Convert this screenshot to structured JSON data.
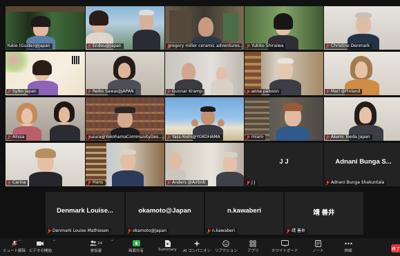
{
  "participants": [
    {
      "name": "Yukie (Guide)@Japan",
      "muted": false
    },
    {
      "name": "Endou@Japan",
      "muted": true
    },
    {
      "name": "gregory miller ceramic adventures...",
      "muted": true
    },
    {
      "name": "Yukiko Shiraiwa",
      "muted": true
    },
    {
      "name": "Christine Denmark",
      "muted": true
    },
    {
      "name": "Syiko Japan",
      "muted": true
    },
    {
      "name": "Reiko Sawai@JAPAN",
      "muted": true
    },
    {
      "name": "Gunnar Kramp",
      "muted": true
    },
    {
      "name": "anna pålsson",
      "muted": true
    },
    {
      "name": "Mari @Finland",
      "muted": true
    },
    {
      "name": "Alissa",
      "muted": true
    },
    {
      "name": "suiura@YokohamaCommunityDes...",
      "muted": true
    },
    {
      "name": "Yass-Yoshi@YOKOHAMA",
      "muted": true
    },
    {
      "name": "miaro",
      "muted": true
    },
    {
      "name": "Akemi Toeda Japan",
      "muted": true
    },
    {
      "name": "Carina",
      "muted": true
    },
    {
      "name": "Hans",
      "muted": true
    },
    {
      "name": "Anders @Airbnb",
      "muted": true
    },
    {
      "name": "J J",
      "display": "J J",
      "muted": true
    },
    {
      "name": "Adnani Bunga Shakuntala",
      "display": "Adnani Bunga S...",
      "muted": true
    },
    {
      "name": "Denmark Louise Mathiesen",
      "display": "Denmark  Louise...",
      "muted": true
    },
    {
      "name": "okamoto@Japan",
      "display": "okamoto@Japan",
      "muted": true
    },
    {
      "name": "n.kawaberi",
      "display": "n.kawaberi",
      "muted": true
    },
    {
      "name": "靖 善井",
      "display": "靖 善井",
      "muted": true
    }
  ],
  "toolbar": {
    "mute": "ミュート解除",
    "video": "ビデオの開始",
    "participants_count": "24",
    "participants": "参加者",
    "share": "画面共有",
    "summary": "Summary",
    "ai": "AI コンパニオン",
    "reactions": "リアクション",
    "apps": "アプリ",
    "whiteboard": "ホワイトボード",
    "notes": "ノート",
    "more": "詳細",
    "end": "終了"
  },
  "colors": {
    "active_speaker": "#c6e04b",
    "end_button": "#e0323a",
    "muted_icon": "#ff4040"
  }
}
